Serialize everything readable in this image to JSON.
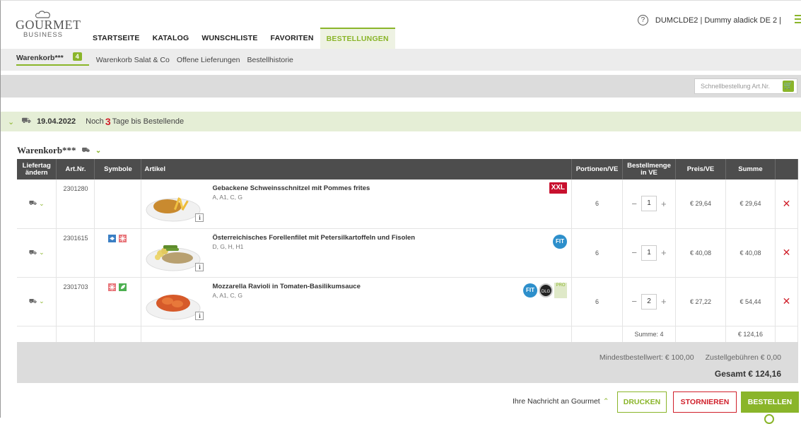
{
  "brand": {
    "line1": "GOURMET",
    "line2": "BUSINESS"
  },
  "nav": {
    "items": [
      "STARTSEITE",
      "KATALOG",
      "WUNSCHLISTE",
      "FAVORITEN",
      "BESTELLUNGEN"
    ],
    "active_index": 4
  },
  "user": {
    "help_glyph": "?",
    "label": "DUMCLDE2 | Dummy aladick DE 2 |"
  },
  "subnav": {
    "cart_label": "Warenkorb***",
    "cart_count": "4",
    "items": [
      "Warenkorb Salat & Co",
      "Offene Lieferungen",
      "Bestellhistorie"
    ]
  },
  "quick_order": {
    "placeholder": "Schnellbestellung Art.Nr."
  },
  "delivery": {
    "date": "19.04.2022",
    "prefix": "Noch",
    "days": "3",
    "suffix": "Tage bis Bestellende"
  },
  "cart_title": "Warenkorb***",
  "table": {
    "headers": {
      "liefertag": "Liefertag ändern",
      "artnr": "Art.Nr.",
      "symbole": "Symbole",
      "artikel": "Artikel",
      "portionen": "Portionen/VE",
      "menge": "Bestellmenge in VE",
      "preis": "Preis/VE",
      "summe": "Summe"
    },
    "rows": [
      {
        "artnr": "2301280",
        "name": "Gebackene Schweinsschnitzel mit Pommes frites",
        "allergens": "A, A1, C, G",
        "portionen": "6",
        "qty": "1",
        "preis": "€ 29,64",
        "summe": "€ 29,64",
        "badges": [
          "XXL"
        ]
      },
      {
        "artnr": "2301615",
        "name": "Österreichisches Forellenfilet mit Petersilkartoffeln und Fisolen",
        "allergens": "D, G, H, H1",
        "portionen": "6",
        "qty": "1",
        "preis": "€ 40,08",
        "summe": "€ 40,08",
        "badges": [
          "FIT"
        ]
      },
      {
        "artnr": "2301703",
        "name": "Mozzarella Ravioli in Tomaten-Basilikumsauce",
        "allergens": "A, A1, C, G",
        "portionen": "6",
        "qty": "2",
        "preis": "€ 27,22",
        "summe": "€ 54,44",
        "badges": [
          "FIT",
          "DLG",
          "PRO"
        ]
      }
    ],
    "sum_label": "Summe: 4",
    "sum_total": "€ 124,16"
  },
  "badges": {
    "xxl": "XXL",
    "fit": "FIT",
    "dlg": "DLG",
    "pro": "PRO"
  },
  "info_glyph": "i",
  "qty_minus": "−",
  "qty_plus": "+",
  "delete_glyph": "✕",
  "summary": {
    "min_order": "Mindestbestellwert: € 100,00",
    "delivery_fee": "Zustellgebühren € 0,00",
    "total": "Gesamt € 124,16"
  },
  "footer": {
    "message": "Ihre Nachricht an Gourmet",
    "print": "DRUCKEN",
    "cancel": "STORNIEREN",
    "order": "BESTELLEN"
  },
  "colors": {
    "accent": "#8ab52a",
    "danger": "#d01f2a",
    "header_dark": "#4d4d4d"
  }
}
